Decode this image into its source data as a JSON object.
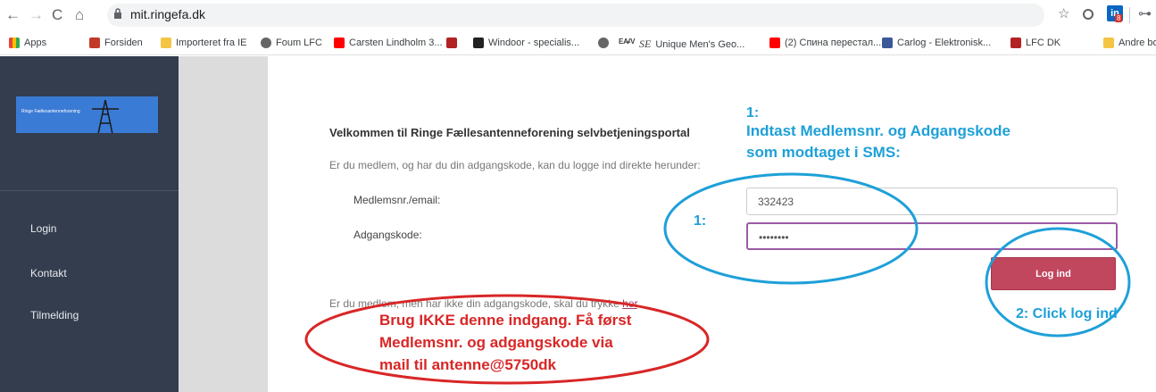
{
  "browser": {
    "url": "mit.ringefa.dk",
    "bookmarks": [
      {
        "label": "Apps",
        "icon": "apps-icon"
      },
      {
        "label": "Forsiden",
        "icon": "site-icon"
      },
      {
        "label": "Importeret fra IE",
        "icon": "folder-icon"
      },
      {
        "label": "Foum LFC",
        "icon": "globe-icon"
      },
      {
        "label": "Carsten Lindholm 3...",
        "icon": "youtube-icon"
      },
      {
        "label": "",
        "icon": "crest-icon"
      },
      {
        "label": "Windoor - specialis...",
        "icon": "site-icon"
      },
      {
        "label": "",
        "icon": "globe-icon"
      },
      {
        "label": "Unique Men's Geo...",
        "icon": "site-icon"
      },
      {
        "label": "(2) Спина перестал...",
        "icon": "youtube-icon"
      },
      {
        "label": "Carlog - Elektronisk...",
        "icon": "site-icon"
      },
      {
        "label": "LFC DK",
        "icon": "crest-icon"
      },
      {
        "label": "Andre bo",
        "icon": "folder-icon"
      }
    ],
    "extension_badge": "8"
  },
  "sidebar": {
    "logo_text": "Ringe Fællesantenneforening",
    "items": [
      {
        "label": "Login"
      },
      {
        "label": "Kontakt"
      },
      {
        "label": "Tilmelding"
      }
    ]
  },
  "main": {
    "welcome": "Velkommen til Ringe Fællesantenneforening selvbetjeningsportal",
    "intro": "Er du medlem, og har du din adgangskode, kan du logge ind direkte herunder:",
    "member_label": "Medlemsnr./email:",
    "member_value": "332423",
    "password_label": "Adgangskode:",
    "password_value": "••••••••",
    "login_button": "Log ind",
    "nocode_text": "Er du medlem, men har ikke din adgangskode, skal du trykke ",
    "nocode_link": "her",
    "nocode_end": "."
  },
  "annotations": {
    "step1_title": "1:",
    "step1_line1": "Indtast Medlemsnr. og Adgangskode",
    "step1_line2": "som modtaget i SMS:",
    "step1_marker": "1:",
    "step2": "2: Click log ind",
    "warning_line1": "Brug IKKE denne indgang. Få først",
    "warning_line2": "Medlemsnr. og adgangskode via",
    "warning_line3": "mail til antenne@5750dk",
    "colors": {
      "blue": "#1ea0d8",
      "red": "#d92626"
    }
  }
}
